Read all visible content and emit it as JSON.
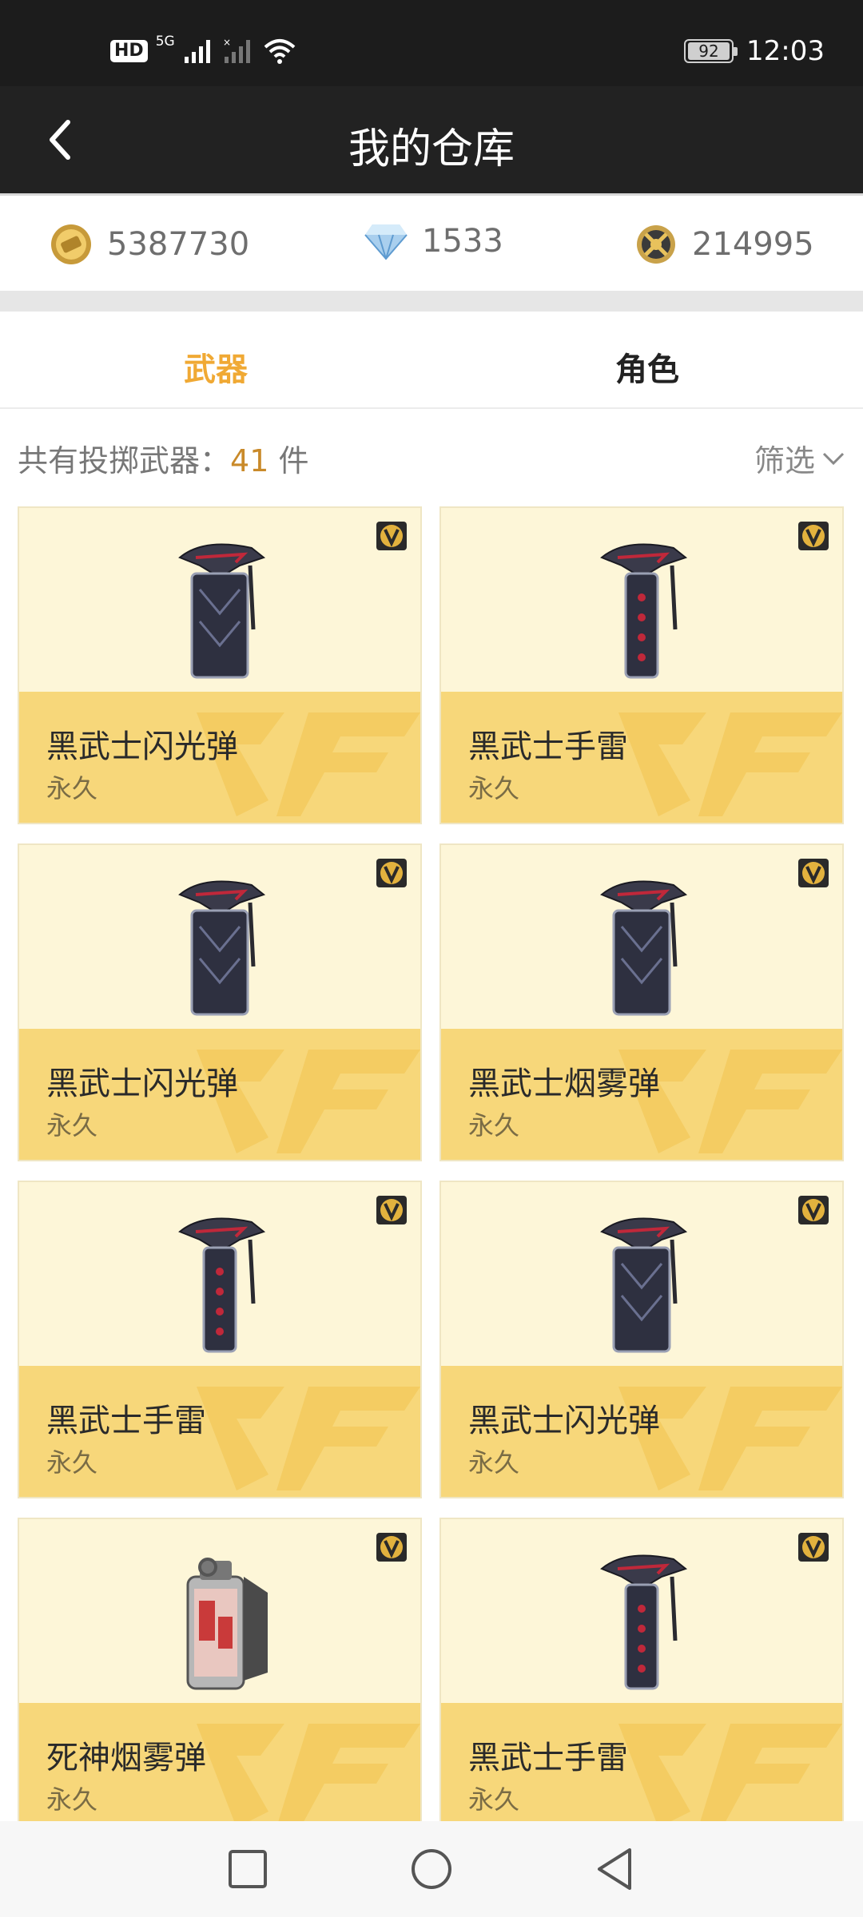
{
  "status_bar": {
    "hd": "HD",
    "network": "5G",
    "battery": "92",
    "time": "12:03"
  },
  "nav": {
    "title": "我的仓库"
  },
  "currencies": [
    {
      "icon": "coin-icon",
      "value": "5387730"
    },
    {
      "icon": "diamond-icon",
      "value": "1533"
    },
    {
      "icon": "medal-icon",
      "value": "214995"
    }
  ],
  "tabs": [
    {
      "label": "武器",
      "active": true
    },
    {
      "label": "角色",
      "active": false
    }
  ],
  "summary": {
    "label": "共有投掷武器：",
    "count": "41",
    "unit": "件"
  },
  "filter": {
    "label": "筛选"
  },
  "items": [
    {
      "name": "黑武士闪光弹",
      "duration": "永久",
      "type": "flash"
    },
    {
      "name": "黑武士手雷",
      "duration": "永久",
      "type": "grenade"
    },
    {
      "name": "黑武士闪光弹",
      "duration": "永久",
      "type": "flash"
    },
    {
      "name": "黑武士烟雾弹",
      "duration": "永久",
      "type": "smoke"
    },
    {
      "name": "黑武士手雷",
      "duration": "永久",
      "type": "grenade"
    },
    {
      "name": "黑武士闪光弹",
      "duration": "永久",
      "type": "flash"
    },
    {
      "name": "死神烟雾弹",
      "duration": "永久",
      "type": "reaper"
    },
    {
      "name": "黑武士手雷",
      "duration": "永久",
      "type": "grenade"
    }
  ],
  "colors": {
    "accent": "#f0a934",
    "card_top": "#fdf6d8",
    "card_bottom": "#f7d77a",
    "header": "#222222"
  }
}
